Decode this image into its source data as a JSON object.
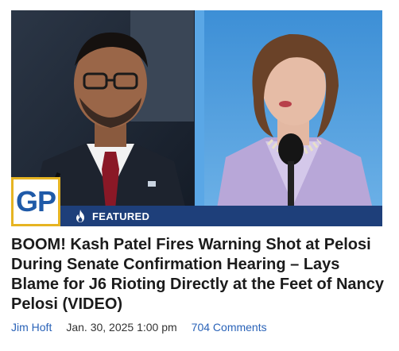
{
  "article": {
    "badge": "GP",
    "featured_label": "FEATURED",
    "headline": "BOOM! Kash Patel Fires Warning Shot at Pelosi During Senate Confirmation Hearing – Lays Blame for J6 Rioting Directly at the Feet of Nancy Pelosi (VIDEO)",
    "author": "Jim Hoft",
    "date": "Jan. 30, 2025 1:00 pm",
    "comments": "704 Comments"
  },
  "colors": {
    "featured_bar": "#1e3f7a",
    "logo_text": "#1f5aa8",
    "logo_border": "#e6b422",
    "link": "#2a63b8",
    "headline": "#1b1b1b"
  },
  "icons": {
    "featured": "flame-icon"
  }
}
